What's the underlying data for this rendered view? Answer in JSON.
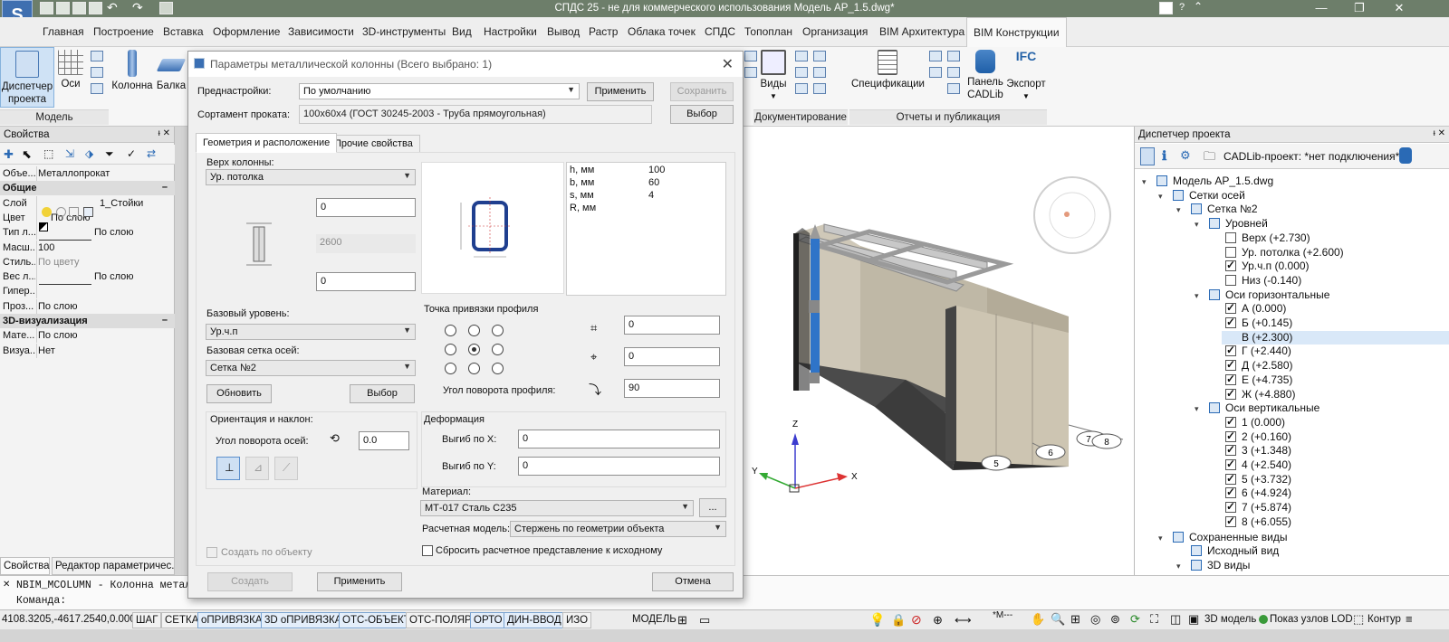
{
  "window": {
    "title": "СПДС 25 - не для коммерческого использования Модель АР_1.5.dwg*"
  },
  "menu_tabs": [
    "Главная",
    "Построение",
    "Вставка",
    "Оформление",
    "Зависимости",
    "3D-инструменты",
    "Вид",
    "Настройки",
    "Вывод",
    "Растр",
    "Облака точек",
    "СПДС",
    "Топоплан",
    "Организация",
    "BIM Архитектура",
    "BIM Конструкции"
  ],
  "ribbon": {
    "dispatcher": "Диспетчер\nпроекта",
    "axes": "Оси",
    "column": "Колонна",
    "beam": "Балка",
    "group_model": "Модель",
    "views": "Виды",
    "group_doc": "Документирование",
    "specs": "Спецификации",
    "panel_cadlib": "Панель\nCADLib",
    "export": "Экспорт",
    "ifc": "IFC",
    "group_reports": "Отчеты и публикация"
  },
  "properties": {
    "header": "Свойства",
    "rows": [
      {
        "k": "Объе...",
        "v": "Металлопрокат",
        "section": false
      },
      {
        "k": "Общие",
        "v": "",
        "section": true
      },
      {
        "k": "Слой",
        "v": "1_Стойки",
        "section": false
      },
      {
        "k": "Цвет",
        "v": "По слою",
        "section": false
      },
      {
        "k": "Тип л...",
        "v": "По слою",
        "section": false
      },
      {
        "k": "Масш...",
        "v": "100",
        "section": false
      },
      {
        "k": "Стиль...",
        "v": "По цвету",
        "section": false
      },
      {
        "k": "Вес л...",
        "v": "По слою",
        "section": false
      },
      {
        "k": "Гипер...",
        "v": "",
        "section": false
      },
      {
        "k": "Проз...",
        "v": "По слою",
        "section": false
      },
      {
        "k": "3D-визуализация",
        "v": "",
        "section": true
      },
      {
        "k": "Мате...",
        "v": "По слою",
        "section": false
      },
      {
        "k": "Визуа...",
        "v": "Нет",
        "section": false
      }
    ],
    "tab1": "Свойства",
    "tab2": "Редактор параметричес..."
  },
  "dialog": {
    "title": "Параметры металлической колонны (Всего выбрано: 1)",
    "presets_label": "Преднастройки:",
    "presets_value": "По умолчанию",
    "apply": "Применить",
    "save": "Сохранить",
    "assortment_label": "Сортамент проката:",
    "assortment_value": "100x60x4 (ГОСТ 30245-2003 - Труба прямоугольная)",
    "choose": "Выбор",
    "tab_geometry": "Геометрия и расположение",
    "tab_other": "Прочие свойства",
    "top_label": "Верх колонны:",
    "top_value": "Ур. потолка",
    "top_offset": "0",
    "height": "2600",
    "bottom_offset": "0",
    "base_level_label": "Базовый уровень:",
    "base_level_value": "Ур.ч.п",
    "base_grid_label": "Базовая сетка осей:",
    "base_grid_value": "Сетка №2",
    "refresh": "Обновить",
    "choose2": "Выбор",
    "orient_label": "Ориентация и наклон:",
    "axes_rotation_label": "Угол поворота осей:",
    "axes_rotation_value": "0.0",
    "create_by_object": "Создать по объекту",
    "props_table": [
      {
        "k": "h, мм",
        "v": "100"
      },
      {
        "k": "b, мм",
        "v": "60"
      },
      {
        "k": "s, мм",
        "v": "4"
      },
      {
        "k": "R, мм",
        "v": ""
      }
    ],
    "anchor_label": "Точка привязки профиля",
    "anchor_x": "0",
    "anchor_y": "0",
    "profile_rotation_label": "Угол поворота профиля:",
    "profile_rotation": "90",
    "deform_label": "Деформация",
    "bend_x_label": "Выгиб по X:",
    "bend_x": "0",
    "bend_y_label": "Выгиб по Y:",
    "bend_y": "0",
    "material_label": "Материал:",
    "material_value": "МТ-017 Сталь С235",
    "more": "...",
    "calc_model_label": "Расчетная модель:",
    "calc_model_value": "Стержень по геометрии объекта",
    "reset_calc": "Сбросить расчетное представление к исходному",
    "create": "Создать",
    "apply2": "Применить",
    "cancel": "Отмена"
  },
  "viewport": {
    "axis_labels": [
      "5",
      "6",
      "7",
      "8"
    ],
    "ucs": {
      "z": "Z",
      "y": "Y",
      "x": "X"
    }
  },
  "project": {
    "header": "Диспетчер проекта",
    "cadlib": "CADLib-проект: *нет подключения*",
    "model": "Модель АР_1.5.dwg",
    "grids": "Сетки осей",
    "grid2": "Сетка №2",
    "levels": "Уровней",
    "level_items": [
      {
        "label": "Верх (+2.730)",
        "checked": false
      },
      {
        "label": "Ур. потолка (+2.600)",
        "checked": false
      },
      {
        "label": "Ур.ч.п (0.000)",
        "checked": true
      },
      {
        "label": "Низ (-0.140)",
        "checked": false
      }
    ],
    "horiz": "Оси горизонтальные",
    "horiz_items": [
      "А (0.000)",
      "Б (+0.145)",
      "В (+2.300)",
      "Г (+2.440)",
      "Д (+2.580)",
      "Е (+4.735)",
      "Ж (+4.880)"
    ],
    "vert": "Оси вертикальные",
    "vert_items": [
      "1 (0.000)",
      "2 (+0.160)",
      "3 (+1.348)",
      "4 (+2.540)",
      "5 (+3.732)",
      "6 (+4.924)",
      "7 (+5.874)",
      "8 (+6.055)"
    ],
    "saved_views": "Сохраненные виды",
    "initial_view": "Исходный вид",
    "views3d": "3D виды"
  },
  "command": {
    "line1": "NBIM_MCOLUMN - Колонна металли",
    "line2": "Команда:"
  },
  "status": {
    "coords": "4108.3205,-4617.2540,0.0000",
    "buttons": [
      "ШАГ",
      "СЕТКА",
      "оПРИВЯЗКА",
      "3D оПРИВЯЗКА",
      "ОТС-ОБЪЕКТ",
      "ОТС-ПОЛЯР",
      "ОРТО",
      "ДИН-ВВОД",
      "ИЗО"
    ],
    "model": "МОДЕЛЬ",
    "scale_marker": "*М---",
    "model3d": "3D модель",
    "show_nodes": "Показ узлов",
    "lod": "LOD",
    "contour": "Контур"
  }
}
